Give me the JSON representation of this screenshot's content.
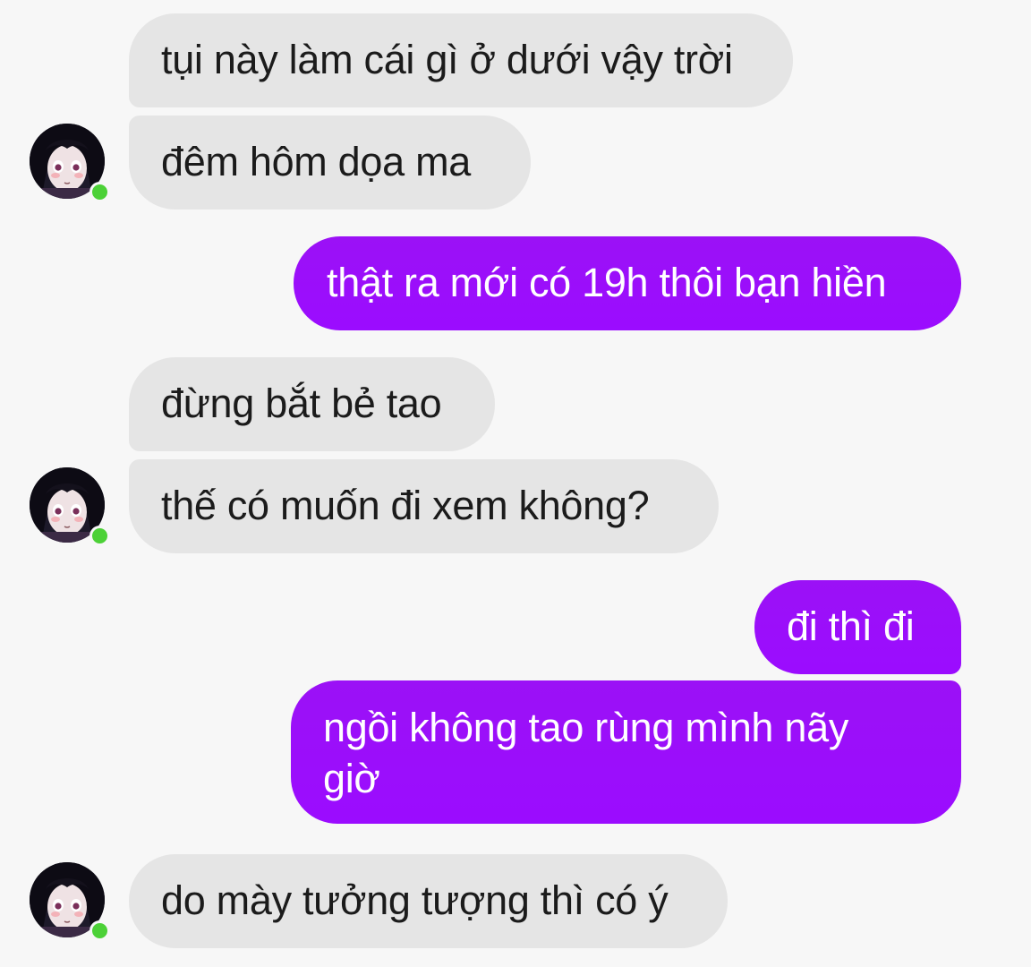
{
  "conversation": {
    "messages": [
      {
        "sender": "contact",
        "text": "tụi này làm cái gì ở dưới vậy trời"
      },
      {
        "sender": "contact",
        "text": "đêm hôm dọa ma"
      },
      {
        "sender": "me",
        "text": "thật ra mới có 19h thôi bạn hiền"
      },
      {
        "sender": "contact",
        "text": "đừng bắt bẻ tao"
      },
      {
        "sender": "contact",
        "text": "thế có muốn đi xem không?"
      },
      {
        "sender": "me",
        "text": "đi thì đi"
      },
      {
        "sender": "me",
        "text": "ngồi không tao rùng mình nãy giờ"
      },
      {
        "sender": "contact",
        "text": "do mày tưởng tượng thì có ý"
      }
    ]
  },
  "contact": {
    "avatar_icon": "anime-girl-avatar-icon",
    "status": "online"
  },
  "colors": {
    "incoming_bubble": "#e5e5e5",
    "outgoing_bubble": "#9b0cff",
    "background": "#f7f7f7",
    "online_dot": "#4cd137"
  }
}
